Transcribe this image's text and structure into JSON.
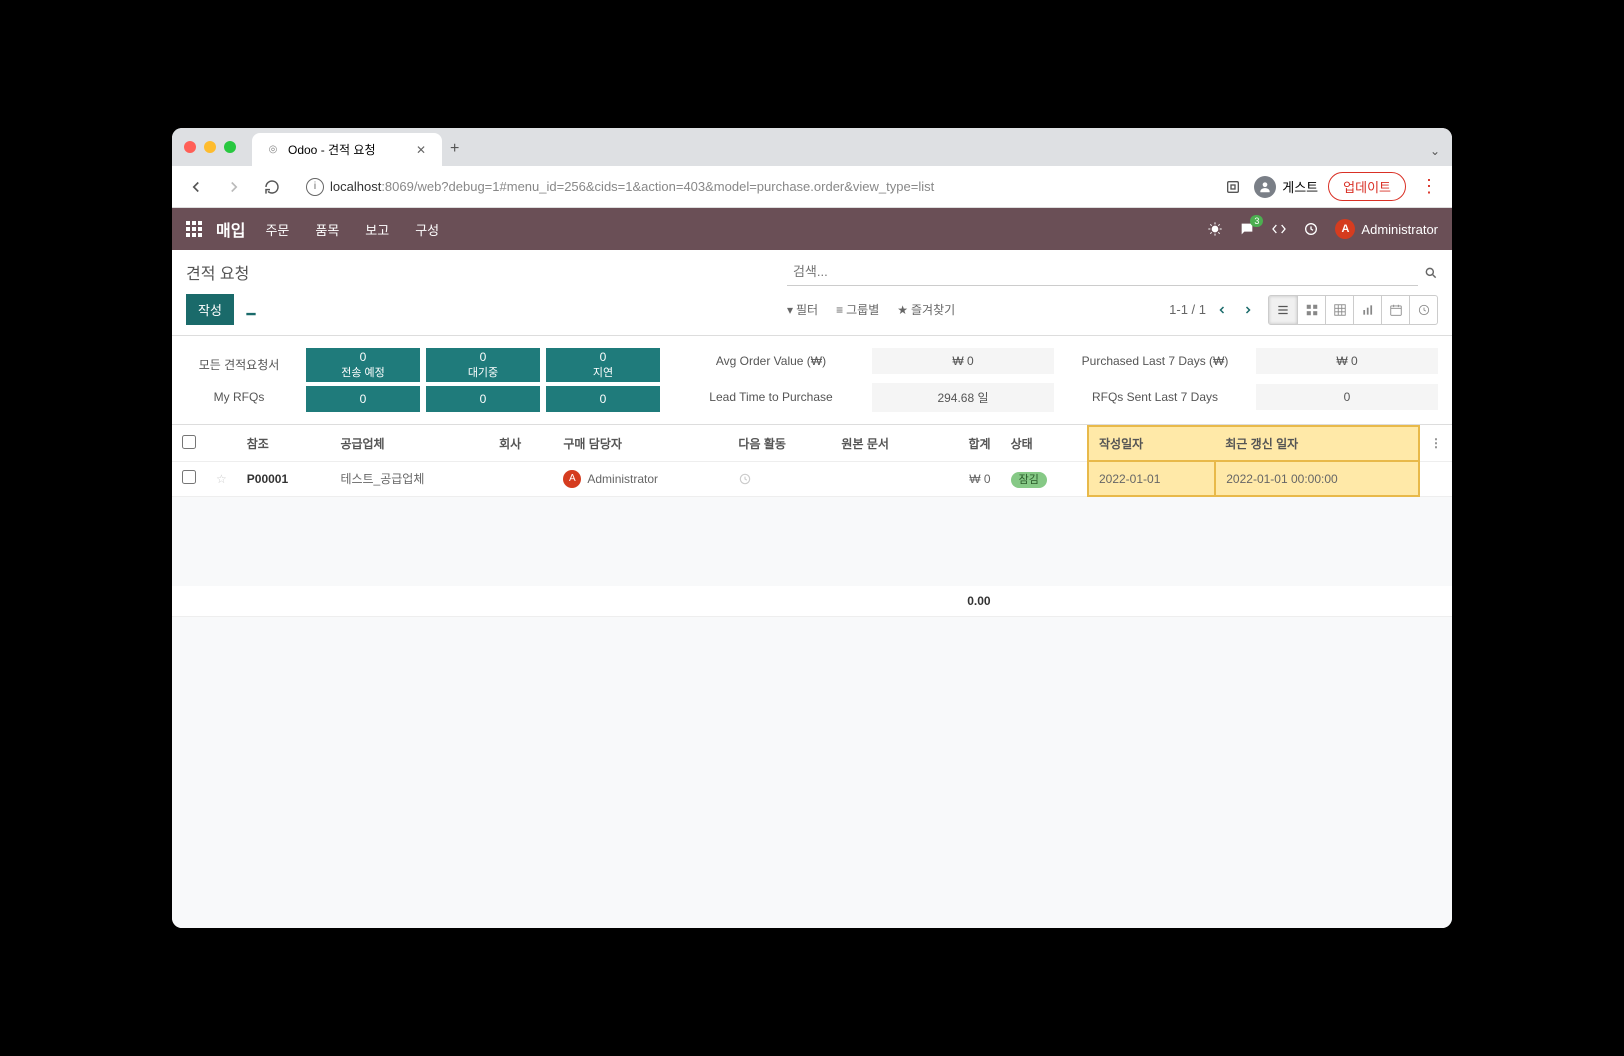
{
  "browser": {
    "tab_title": "Odoo - 견적 요청",
    "url_host": "localhost",
    "url_port_path": ":8069/web?debug=1#menu_id=256&cids=1&action=403&model=purchase.order&view_type=list",
    "guest_label": "게스트",
    "update_label": "업데이트"
  },
  "navbar": {
    "app": "매입",
    "menus": [
      "주문",
      "품목",
      "보고",
      "구성"
    ],
    "badge": "3",
    "user_initial": "A",
    "user_name": "Administrator"
  },
  "control": {
    "breadcrumb": "견적 요청",
    "search_placeholder": "검색...",
    "create": "작성",
    "filters": [
      "필터",
      "그룹별",
      "즐겨찾기"
    ],
    "pager": "1-1 / 1"
  },
  "dashboard": {
    "row_labels": [
      "모든 견적요청서",
      "My RFQs"
    ],
    "cols": [
      {
        "top_num": "0",
        "top_label": "전송 예정",
        "bottom": "0"
      },
      {
        "top_num": "0",
        "top_label": "대기중",
        "bottom": "0"
      },
      {
        "top_num": "0",
        "top_label": "지연",
        "bottom": "0"
      }
    ],
    "stats": {
      "avg_label": "Avg Order Value (₩)",
      "avg_val": "₩ 0",
      "lead_label": "Lead Time to Purchase",
      "lead_val": "294.68 일",
      "purch_label": "Purchased Last 7 Days (₩)",
      "purch_val": "₩ 0",
      "rfq_label": "RFQs Sent Last 7 Days",
      "rfq_val": "0"
    }
  },
  "table": {
    "headers": {
      "ref": "참조",
      "vendor": "공급업체",
      "company": "회사",
      "buyer": "구매 담당자",
      "activity": "다음 활동",
      "source": "원본 문서",
      "total": "합계",
      "status": "상태",
      "create": "작성일자",
      "write": "최근 갱신 일자"
    },
    "row": {
      "ref": "P00001",
      "vendor": "테스트_공급업체",
      "buyer_initial": "A",
      "buyer": "Administrator",
      "total": "₩ 0",
      "status": "잠김",
      "create": "2022-01-01",
      "write": "2022-01-01 00:00:00"
    },
    "sum": "0.00"
  }
}
